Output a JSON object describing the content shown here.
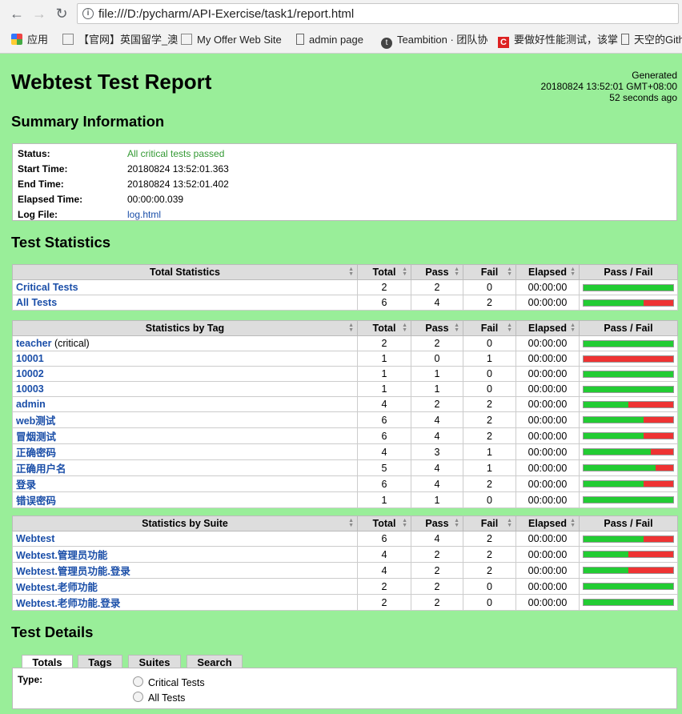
{
  "browser": {
    "url": "file:///D:/pycharm/API-Exercise/task1/report.html",
    "bookmarks": [
      "应用",
      "【官网】英国留学_澳",
      "My Offer Web Site",
      "admin page",
      "Teambition · 团队协",
      "要做好性能测试，该掌",
      "天空的Gith"
    ]
  },
  "header": {
    "title": "Webtest Test Report",
    "generated_label": "Generated",
    "generated_time": "20180824 13:52:01 GMT+08:00",
    "generated_ago": "52 seconds ago"
  },
  "summary": {
    "heading": "Summary Information",
    "rows": [
      {
        "key": "Status:",
        "value": "All critical tests passed"
      },
      {
        "key": "Start Time:",
        "value": "20180824 13:52:01.363"
      },
      {
        "key": "End Time:",
        "value": "20180824 13:52:01.402"
      },
      {
        "key": "Elapsed Time:",
        "value": "00:00:00.039"
      },
      {
        "key": "Log File:",
        "value": "log.html"
      }
    ]
  },
  "stats_heading": "Test Statistics",
  "columns": [
    "Total",
    "Pass",
    "Fail",
    "Elapsed",
    "Pass / Fail"
  ],
  "total_stats": {
    "header": "Total Statistics",
    "rows": [
      {
        "name": "Critical Tests",
        "total": "2",
        "pass": "2",
        "fail": "0",
        "elapsed": "00:00:00"
      },
      {
        "name": "All Tests",
        "total": "6",
        "pass": "4",
        "fail": "2",
        "elapsed": "00:00:00"
      }
    ]
  },
  "tag_stats": {
    "header": "Statistics by Tag",
    "rows": [
      {
        "name": "teacher",
        "note": "(critical)",
        "total": "2",
        "pass": "2",
        "fail": "0",
        "elapsed": "00:00:00"
      },
      {
        "name": "10001",
        "total": "1",
        "pass": "0",
        "fail": "1",
        "elapsed": "00:00:00"
      },
      {
        "name": "10002",
        "total": "1",
        "pass": "1",
        "fail": "0",
        "elapsed": "00:00:00"
      },
      {
        "name": "10003",
        "total": "1",
        "pass": "1",
        "fail": "0",
        "elapsed": "00:00:00"
      },
      {
        "name": "admin",
        "total": "4",
        "pass": "2",
        "fail": "2",
        "elapsed": "00:00:00"
      },
      {
        "name": "web测试",
        "total": "6",
        "pass": "4",
        "fail": "2",
        "elapsed": "00:00:00"
      },
      {
        "name": "冒烟测试",
        "total": "6",
        "pass": "4",
        "fail": "2",
        "elapsed": "00:00:00"
      },
      {
        "name": "正确密码",
        "total": "4",
        "pass": "3",
        "fail": "1",
        "elapsed": "00:00:00"
      },
      {
        "name": "正确用户名",
        "total": "5",
        "pass": "4",
        "fail": "1",
        "elapsed": "00:00:00"
      },
      {
        "name": "登录",
        "total": "6",
        "pass": "4",
        "fail": "2",
        "elapsed": "00:00:00"
      },
      {
        "name": "错误密码",
        "total": "1",
        "pass": "1",
        "fail": "0",
        "elapsed": "00:00:00"
      }
    ]
  },
  "suite_stats": {
    "header": "Statistics by Suite",
    "rows": [
      {
        "name": "Webtest",
        "total": "6",
        "pass": "4",
        "fail": "2",
        "elapsed": "00:00:00"
      },
      {
        "name": "Webtest.管理员功能",
        "total": "4",
        "pass": "2",
        "fail": "2",
        "elapsed": "00:00:00"
      },
      {
        "name": "Webtest.管理员功能.登录",
        "total": "4",
        "pass": "2",
        "fail": "2",
        "elapsed": "00:00:00"
      },
      {
        "name": "Webtest.老师功能",
        "total": "2",
        "pass": "2",
        "fail": "0",
        "elapsed": "00:00:00"
      },
      {
        "name": "Webtest.老师功能.登录",
        "total": "2",
        "pass": "2",
        "fail": "0",
        "elapsed": "00:00:00"
      }
    ]
  },
  "details": {
    "heading": "Test Details",
    "tabs": [
      "Totals",
      "Tags",
      "Suites",
      "Search"
    ],
    "type_label": "Type:",
    "options": [
      "Critical Tests",
      "All Tests"
    ]
  },
  "colors": {
    "background": "#99ee99",
    "pass": "#22cc33",
    "fail": "#ee3333",
    "link": "#1a4ea8"
  }
}
